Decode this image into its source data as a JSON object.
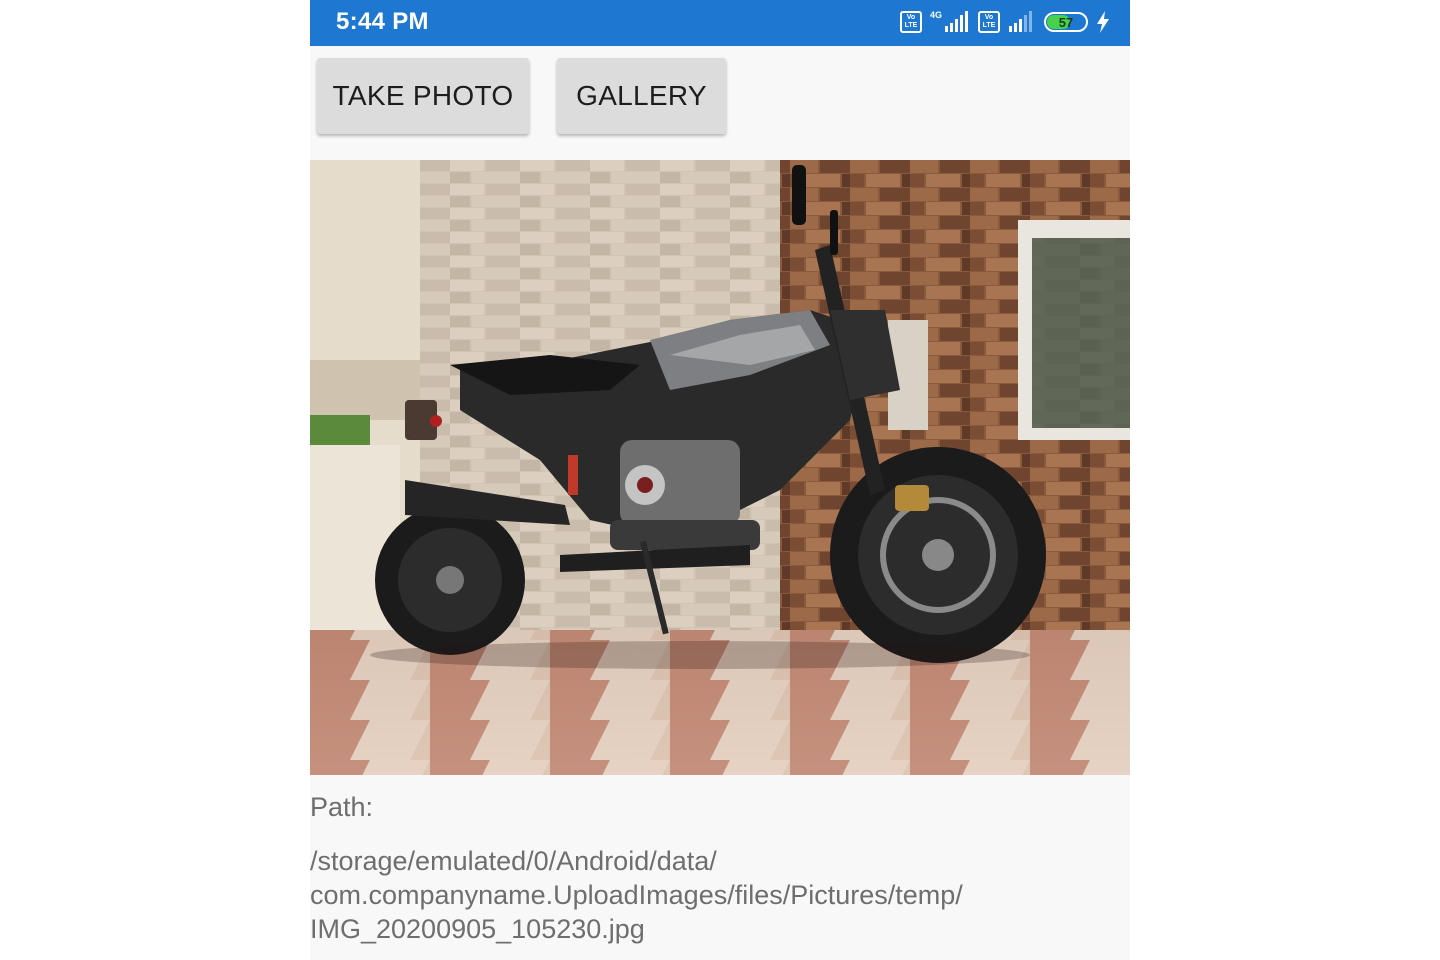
{
  "status_bar": {
    "time": "5:44 PM",
    "volte_label_1": "Vo LTE",
    "network_type": "4G",
    "volte_label_2": "Vo LTE",
    "battery_level": "57",
    "charging": true,
    "background_color": "#1e78d2"
  },
  "toolbar": {
    "take_photo_label": "TAKE PHOTO",
    "gallery_label": "GALLERY"
  },
  "photo": {
    "icon": "motorcycle-photo"
  },
  "path": {
    "label": "Path:",
    "line1": "/storage/emulated/0/Android/data/",
    "line2": "com.companyname.UploadImages/files/Pictures/temp/",
    "line3": "IMG_20200905_105230.jpg"
  }
}
